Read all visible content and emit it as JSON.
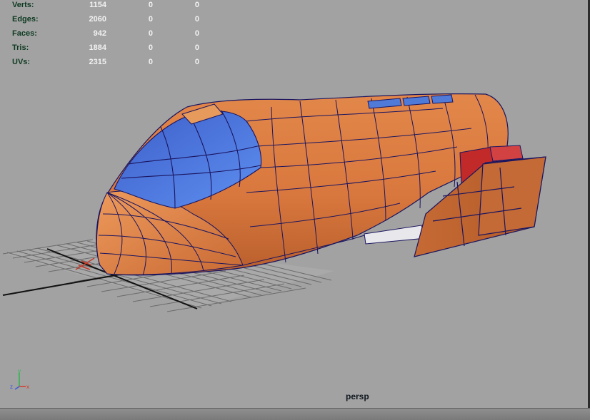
{
  "hud": {
    "rows": [
      {
        "label": "Verts:",
        "v1": "1154",
        "v2": "0",
        "v3": "0"
      },
      {
        "label": "Edges:",
        "v1": "2060",
        "v2": "0",
        "v3": "0"
      },
      {
        "label": "Faces:",
        "v1": "942",
        "v2": "0",
        "v3": "0"
      },
      {
        "label": "Tris:",
        "v1": "1884",
        "v2": "0",
        "v3": "0"
      },
      {
        "label": "UVs:",
        "v1": "2315",
        "v2": "0",
        "v3": "0"
      }
    ]
  },
  "camera": {
    "name": "persp"
  },
  "axes": {
    "y": "y",
    "x": "x",
    "z": "z"
  },
  "colors": {
    "viewport_bg": "#a2a2a2",
    "hull": "#d9783e",
    "canopy": "#4f7ad8",
    "wire": "#1a1560",
    "light": "#c22a2a",
    "grid": "#5a5a5a"
  }
}
